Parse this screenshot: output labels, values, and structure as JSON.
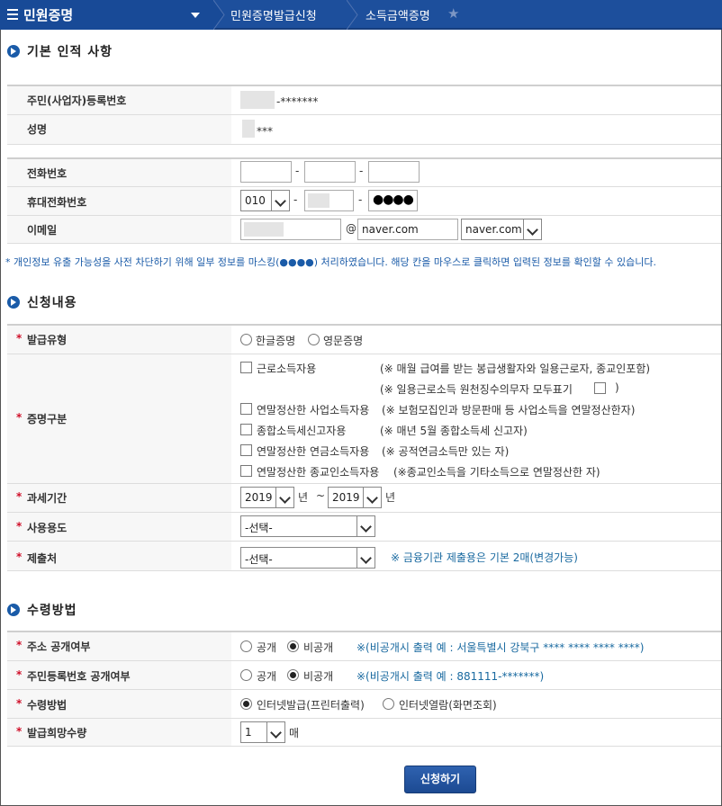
{
  "nav": {
    "title": "민원증명",
    "crumbs": [
      "민원증명발급신청",
      "소득금액증명"
    ]
  },
  "basic": {
    "heading": "기본 인적 사항",
    "id_label": "주민(사업자)등록번호",
    "id_value": "-*******",
    "name_label": "성명",
    "name_value": "***"
  },
  "contact": {
    "phone_label": "전화번호",
    "mobile_label": "휴대전화번호",
    "mobile_prefix": "010",
    "mobile_last": "●●●●",
    "email_label": "이메일",
    "email_at": "@",
    "email_domain": "naver.com",
    "email_domain_select": "naver.com",
    "dash": "-"
  },
  "mask_notice": "* 개인정보 유출 가능성을 사전 차단하기 위해 일부 정보를 마스킹(●●●●) 처리하였습니다. 해당 칸을 마우스로 클릭하면 입력된 정보를 확인할 수 있습니다.",
  "request": {
    "heading": "신청내용",
    "issue_type_label": "발급유형",
    "issue_types": [
      "한글증명",
      "영문증명"
    ],
    "cert_label": "증명구분",
    "cert_options": [
      {
        "label": "근로소득자용",
        "note": "(※ 매월 급여를 받는 봉급생활자와 일용근로자, 종교인포함)"
      },
      {
        "label": "",
        "note": "(※ 일용근로소득 원천징수의무자 모두표기 ",
        "note_end": ")"
      },
      {
        "label": "연말정산한 사업소득자용",
        "note": "(※ 보험모집인과 방문판매 등 사업소득을 연말정산한자)"
      },
      {
        "label": "종합소득세신고자용",
        "note": "(※ 매년 5월 종합소득세 신고자)"
      },
      {
        "label": "연말정산한 연금소득자용",
        "note": "(※ 공적연금소득만 있는 자)"
      },
      {
        "label": "연말정산한 종교인소득자용",
        "note": "(※종교인소득을 기타소득으로 연말정산한 자)"
      }
    ],
    "period_label": "과세기간",
    "period_from": "2019",
    "period_to": "2019",
    "year_unit": "년",
    "tilde": "~",
    "usage_label": "사용용도",
    "usage_value": "-선택-",
    "submit_to_label": "제출처",
    "submit_to_value": "-선택-",
    "submit_to_note": "※ 금융기관 제출용은 기본 2매(변경가능)"
  },
  "receive": {
    "heading": "수령방법",
    "addr_label": "주소 공개여부",
    "id_label": "주민등록번호 공개여부",
    "open": "공개",
    "closed": "비공개",
    "addr_note": "※(비공개시 출력 예 : 서울특별시 강북구 **** **** **** ****)",
    "id_note": "※(비공개시 출력 예 : 881111-*******)",
    "method_label": "수령방법",
    "methods": [
      "인터넷발급(프린터출력)",
      "인터넷열람(화면조회)"
    ],
    "qty_label": "발급희망수량",
    "qty_value": "1",
    "qty_unit": "매"
  },
  "submit_label": "신청하기"
}
